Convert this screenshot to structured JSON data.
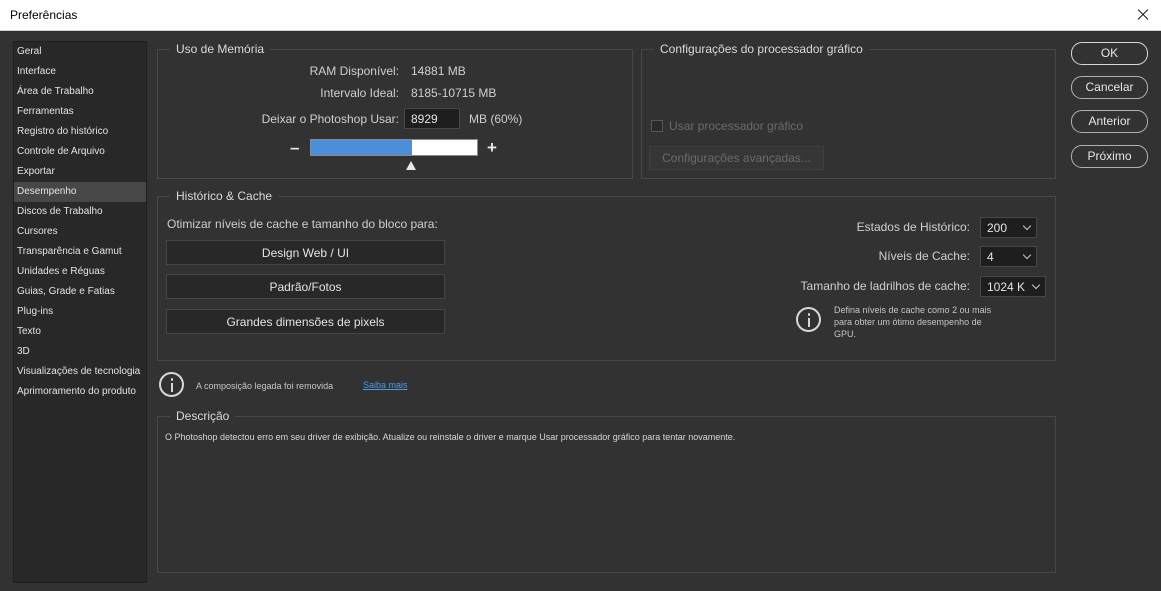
{
  "window": {
    "title": "Preferências"
  },
  "sidebar": {
    "items": [
      "Geral",
      "Interface",
      "Área de Trabalho",
      "Ferramentas",
      "Registro do histórico",
      "Controle de Arquivo",
      "Exportar",
      "Desempenho",
      "Discos de Trabalho",
      "Cursores",
      "Transparência e Gamut",
      "Unidades e Réguas",
      "Guias, Grade e Fatias",
      "Plug-ins",
      "Texto",
      "3D",
      "Visualizações de tecnologia",
      "Aprimoramento do produto"
    ],
    "selected_index": 7
  },
  "memory": {
    "title": "Uso de Memória",
    "ram_label": "RAM Disponível:",
    "ram_value": "14881 MB",
    "ideal_label": "Intervalo Ideal:",
    "ideal_value": "8185-10715 MB",
    "use_label": "Deixar o Photoshop Usar:",
    "use_value": "8929",
    "use_suffix": "MB (60%)",
    "minus": "–",
    "plus": "+",
    "slider_fraction": 0.6
  },
  "gpu": {
    "title": "Configurações do processador gráfico",
    "use_gpu_label": "Usar processador gráfico",
    "advanced_label": "Configurações avançadas..."
  },
  "cache": {
    "title": "Histórico & Cache",
    "optimize_label": "Otimizar níveis de cache e tamanho do bloco para:",
    "btn_web": "Design Web / UI",
    "btn_photo": "Padrão/Fotos",
    "btn_large": "Grandes dimensões de pixels",
    "history_label": "Estados de Histórico:",
    "history_value": "200",
    "levels_label": "Níveis de Cache:",
    "levels_value": "4",
    "tile_label": "Tamanho de ladrilhos de cache:",
    "tile_value": "1024 K",
    "hint_line1": "Defina níveis de cache como 2 ou mais",
    "hint_line2": "para obter um ótimo desempenho de",
    "hint_line3": "GPU."
  },
  "notice": {
    "text": "A composição legada foi removida",
    "link": "Saiba mais"
  },
  "description": {
    "title": "Descrição",
    "text": "O Photoshop detectou erro em seu driver de exibição. Atualize ou reinstale o driver e marque Usar processador gráfico para tentar novamente."
  },
  "buttons": {
    "ok": "OK",
    "cancel": "Cancelar",
    "prev": "Anterior",
    "next": "Próximo"
  }
}
